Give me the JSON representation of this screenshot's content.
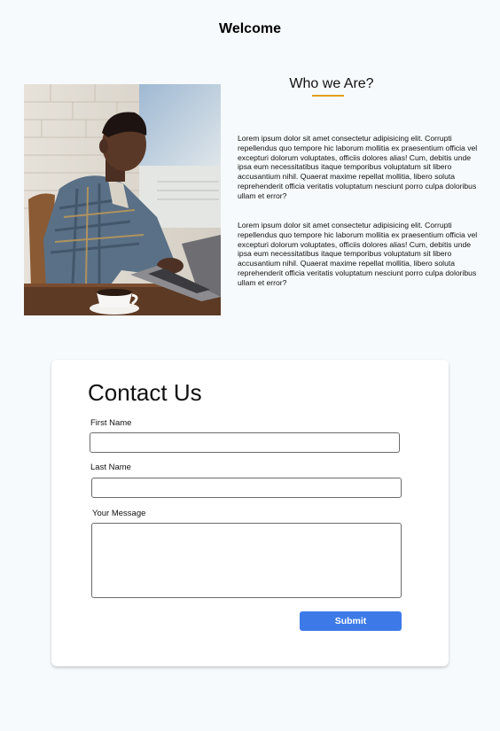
{
  "header": {
    "title": "Welcome"
  },
  "about": {
    "title": "Who we Are?",
    "accent_color": "#e39e1c",
    "paragraphs": [
      "Lorem ipsum dolor sit amet consectetur adipisicing elit. Corrupti repellendus quo tempore hic laborum mollitia ex praesentium officia vel excepturi dolorum voluptates, officiis dolores alias! Cum, debitis unde ipsa eum necessitatibus itaque temporibus voluptatum sit libero accusantium nihil. Quaerat maxime repellat mollitia, libero soluta reprehenderit officia veritatis voluptatum nesciunt porro culpa doloribus ullam et error?",
      "Lorem ipsum dolor sit amet consectetur adipisicing elit. Corrupti repellendus quo tempore hic laborum mollitia ex praesentium officia vel excepturi dolorum voluptates, officiis dolores alias! Cum, debitis unde ipsa eum necessitatibus itaque temporibus voluptatum sit libero accusantium nihil. Quaerat maxime repellat mollitia, libero soluta reprehenderit officia veritatis voluptatum nesciunt porro culpa doloribus ullam et error?"
    ]
  },
  "contact": {
    "title": "Contact Us",
    "first_name_label": "First Name",
    "first_name_value": "",
    "last_name_label": "Last Name",
    "last_name_value": "",
    "message_label": "Your Message",
    "message_value": "",
    "submit_label": "Submit",
    "submit_color": "#3d7ae8"
  }
}
